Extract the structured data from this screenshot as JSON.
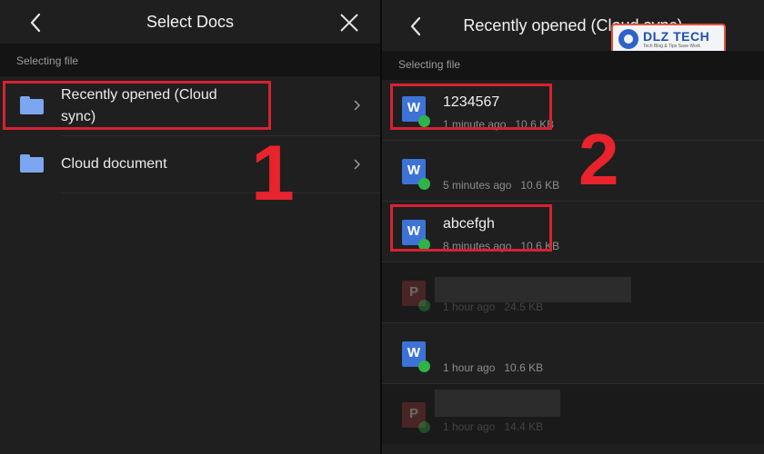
{
  "left": {
    "title": "Select Docs",
    "section": "Selecting file",
    "items": [
      {
        "label": "Recently opened (Cloud sync)",
        "icon": "folder-icon"
      },
      {
        "label": "Cloud document",
        "icon": "folder-icon"
      }
    ],
    "annotation": "1"
  },
  "right": {
    "title": "Recently opened (Cloud sync)",
    "section": "Selecting file",
    "files": [
      {
        "name": "1234567",
        "meta": "1 minute ago   10.6 KB",
        "type": "word"
      },
      {
        "name": "",
        "meta": "5 minutes ago   10.6 KB",
        "type": "word"
      },
      {
        "name": "abcefgh",
        "meta": "8 minutes ago   10.6 KB",
        "type": "word"
      },
      {
        "name": "",
        "meta": "1 hour ago   24.5 KB",
        "type": "pdf"
      },
      {
        "name": "",
        "meta": "1 hour ago   10.6 KB",
        "type": "word"
      },
      {
        "name": "",
        "meta": "1 hour ago   14.4 KB",
        "type": "pdf"
      }
    ],
    "annotation": "2"
  },
  "watermark": {
    "brand": "DLZ TECH",
    "tagline": "Tech Blog & Tips Save Work"
  },
  "colors": {
    "accent_red": "#d62230",
    "folder": "#7da6f0",
    "word": "#3d73d6",
    "pdf": "#a23b3b",
    "check": "#2fb34a"
  }
}
